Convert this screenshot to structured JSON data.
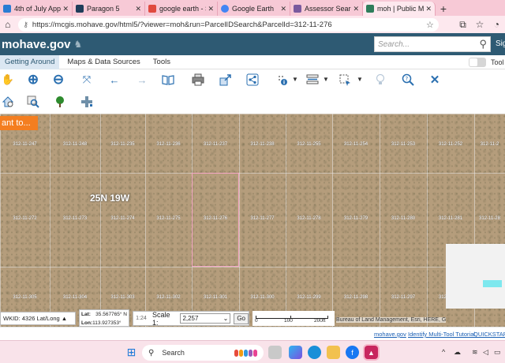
{
  "browser": {
    "tabs": [
      {
        "label": "4th of July Applie",
        "color": "#2b7cd3"
      },
      {
        "label": "Paragon 5",
        "color": "#1f3d5a"
      },
      {
        "label": "google earth - Sear",
        "color": "#e04a3f"
      },
      {
        "label": "Google Earth",
        "color": "#4285f4"
      },
      {
        "label": "Assessor Search | I",
        "color": "#7a5a9e"
      },
      {
        "label": "moh | Public Map \\",
        "color": "#2e7d5b"
      }
    ],
    "active_tab": 5,
    "new_tab_symbol": "+",
    "url": "https://mcgis.mohave.gov/html5/?viewer=moh&run=ParcelIDSearch&ParcelId=312-11-276"
  },
  "site": {
    "brand": "mohave.gov",
    "search_placeholder": "Search...",
    "sign_in": "Sig"
  },
  "menu": {
    "tabs": [
      "Getting Around",
      "Maps & Data Sources",
      "Tools"
    ],
    "active": 0,
    "tool_label": "Tool"
  },
  "toolbar_row1": [
    {
      "name": "pan-hand-icon",
      "glyph": "✋"
    },
    {
      "name": "zoom-in-icon",
      "glyph": "+"
    },
    {
      "name": "zoom-out-icon",
      "glyph": "−"
    },
    {
      "name": "full-extent-icon",
      "glyph": "⤧"
    },
    {
      "name": "previous-extent-icon",
      "glyph": "←"
    },
    {
      "name": "next-extent-icon",
      "glyph": "→"
    },
    {
      "name": "bookmarks-icon",
      "glyph": "📖"
    },
    {
      "name": "print-icon",
      "glyph": "🖶"
    },
    {
      "name": "export-icon",
      "glyph": "↗"
    },
    {
      "name": "share-icon",
      "glyph": "⇪"
    },
    {
      "name": "identify-icon",
      "glyph": "ℹ"
    },
    {
      "name": "measure-icon",
      "glyph": "⇔"
    },
    {
      "name": "select-icon",
      "glyph": "⬚"
    },
    {
      "name": "tips-icon",
      "glyph": "💡"
    },
    {
      "name": "find-icon",
      "glyph": "?"
    },
    {
      "name": "close-icon",
      "glyph": "✕"
    }
  ],
  "toolbar_row2": [
    {
      "name": "home-search-icon",
      "glyph": "⌂"
    },
    {
      "name": "query-icon",
      "glyph": "🔍"
    },
    {
      "name": "tree-layer-icon",
      "glyph": "♣"
    },
    {
      "name": "draw-plus-icon",
      "glyph": "✚"
    }
  ],
  "map": {
    "banner": "ant to...",
    "township_label": "25N 19W",
    "parcel_rows": [
      [
        "312-11-247",
        "312-11-248",
        "312-11-235",
        "312-11-236",
        "312-11-237",
        "312-11-238",
        "312-11-255",
        "312-11-254",
        "312-11-253",
        "312-11-252",
        "312-11-2"
      ],
      [
        "312-11-272",
        "312-11-273",
        "312-11-274",
        "312-11-275",
        "312-11-276",
        "312-11-277",
        "312-11-278",
        "312-11-279",
        "312-11-280",
        "312-11-281",
        "312-11-28"
      ],
      [
        "312-11-305",
        "312-11-304",
        "312-11-303",
        "312-11-302",
        "312-11-301",
        "312-11-300",
        "312-11-299",
        "312-11-298",
        "312-11-297",
        "312-11-296",
        "312-11-2"
      ]
    ]
  },
  "status": {
    "wkid": "WKID: 4326 Lat/Long",
    "lat_label": "Lat:",
    "lat_value": "35.567765° N",
    "lon_label": "Lon:",
    "lon_value": "113.927353° W",
    "scale_icon": "1:24",
    "scale_label": "Scale 1:",
    "scale_value": "2,257",
    "go_label": "Go",
    "scalebar_ticks": [
      "0",
      "100",
      "200ft"
    ],
    "attribution": "Bureau of Land Management, Esri, HERE, G"
  },
  "footer": {
    "links": [
      "mohave.gov",
      "Identify Multi-Tool Tutorial",
      "QUICKSTART"
    ]
  },
  "taskbar": {
    "search_placeholder": "Search"
  }
}
